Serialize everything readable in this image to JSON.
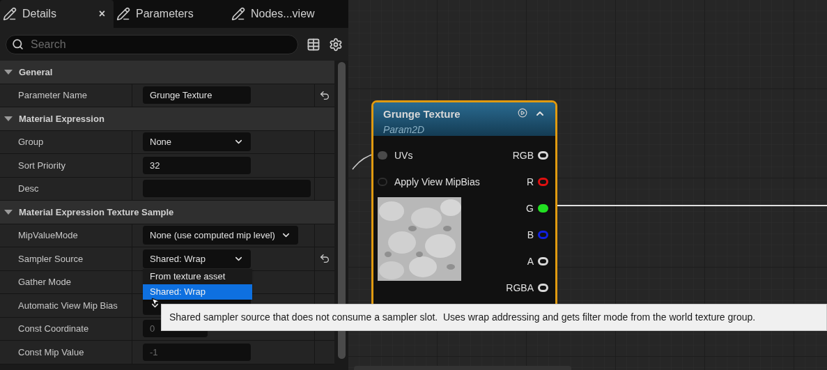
{
  "tabs": [
    {
      "label": "Details",
      "selected": true,
      "close": "×"
    },
    {
      "label": "Parameters",
      "selected": false
    },
    {
      "label": "Nodes...view",
      "selected": false
    }
  ],
  "search": {
    "placeholder": "Search"
  },
  "sections": [
    {
      "title": "General",
      "expanded": true,
      "rows": [
        {
          "label": "Parameter Name",
          "kind": "text",
          "value": "Grunge Texture",
          "resettable": true
        }
      ]
    },
    {
      "title": "Material Expression",
      "expanded": true,
      "rows": [
        {
          "label": "Group",
          "kind": "dropdown",
          "value": "None",
          "resettable": false
        },
        {
          "label": "Sort Priority",
          "kind": "text",
          "value": "32",
          "resettable": false
        },
        {
          "label": "Desc",
          "kind": "textarea",
          "resettable": false
        }
      ]
    },
    {
      "title": "Material Expression Texture Sample",
      "expanded": true,
      "rows": [
        {
          "label": "MipValueMode",
          "kind": "dropdown",
          "value": "None (use computed mip level)",
          "resettable": false
        },
        {
          "label": "Sampler Source",
          "kind": "dropdown",
          "value": "Shared: Wrap",
          "resettable": true
        },
        {
          "label": "Gather Mode",
          "resettable": false
        },
        {
          "label": "Automatic View Mip Bias",
          "kind": "dropdown",
          "resettable": false
        },
        {
          "label": "Const Coordinate",
          "kind": "number",
          "value": "0",
          "disabled": true,
          "resettable": false
        },
        {
          "label": "Const Mip Value",
          "kind": "text",
          "value": "-1",
          "disabled": true,
          "resettable": false
        }
      ]
    }
  ],
  "popup": {
    "options": [
      {
        "label": "From texture asset",
        "selected": false
      },
      {
        "label": "Shared: Wrap",
        "selected": true
      }
    ]
  },
  "tooltip": "Shared sampler source that does not consume a sampler slot.  Uses wrap addressing and gets filter mode from the world texture group.",
  "node": {
    "title": "Grunge Texture",
    "subtitle": "Param2D",
    "selected": true,
    "inputs": [
      {
        "label": "UVs",
        "connected": true
      },
      {
        "label": "Apply View MipBias",
        "connected": false
      }
    ],
    "outputs": [
      {
        "label": "RGB",
        "color": "#d8d8d8",
        "connected": false
      },
      {
        "label": "R",
        "color": "#e01010",
        "connected": false
      },
      {
        "label": "G",
        "color": "#22e022",
        "connected": true
      },
      {
        "label": "B",
        "color": "#1020e0",
        "connected": false
      },
      {
        "label": "A",
        "color": "#d8d8d8",
        "connected": false
      },
      {
        "label": "RGBA",
        "color": "#d8d8d8",
        "connected": false
      }
    ]
  }
}
